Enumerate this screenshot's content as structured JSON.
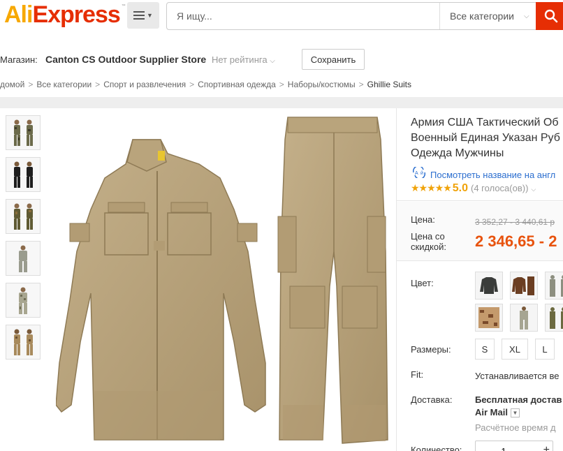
{
  "header": {
    "logo_ali": "Ali",
    "logo_express": "Express",
    "search_placeholder": "Я ищу...",
    "category_label": "Все категории"
  },
  "store": {
    "label": "Магазин:",
    "name": "Canton CS Outdoor Supplier Store",
    "rating": "Нет рейтинга",
    "save_label": "Сохранить"
  },
  "breadcrumb": [
    "домой",
    "Все категории",
    "Спорт и развлечения",
    "Спортивная одежда",
    "Наборы/костюмы",
    "Ghillie Suits"
  ],
  "product": {
    "title_lines": [
      "Армия США Тактический Об",
      "Военный Единая Указан Руб",
      "Одежда Мужчины"
    ],
    "translate_link": "Посмотреть название на англ",
    "stars": "★★★★★",
    "score": "5.0",
    "votes": "(4 голоса(ов))"
  },
  "pricing": {
    "price_label": "Цена:",
    "old_price": "3 352,27 - 3 440,61 р",
    "discount_label_1": "Цена со",
    "discount_label_2": "скидкой:",
    "new_price": "2 346,65 - 2"
  },
  "options": {
    "color_label": "Цвет:",
    "sizes_label": "Размеры:",
    "sizes": [
      "S",
      "XL",
      "L"
    ],
    "fit_label": "Fit:",
    "fit_value": "Устанавливается ве",
    "delivery_label": "Доставка:",
    "delivery_free": "Бесплатная достав",
    "delivery_method": "Air Mail",
    "delivery_time": "Расчётное время д",
    "quantity_label": "Количество:",
    "quantity_value": "1"
  },
  "colors": {
    "accent": "#e62e04",
    "price": "#e8530e",
    "star": "#f0a30a",
    "link": "#2b6ecf",
    "khaki": "#b8a27c"
  }
}
